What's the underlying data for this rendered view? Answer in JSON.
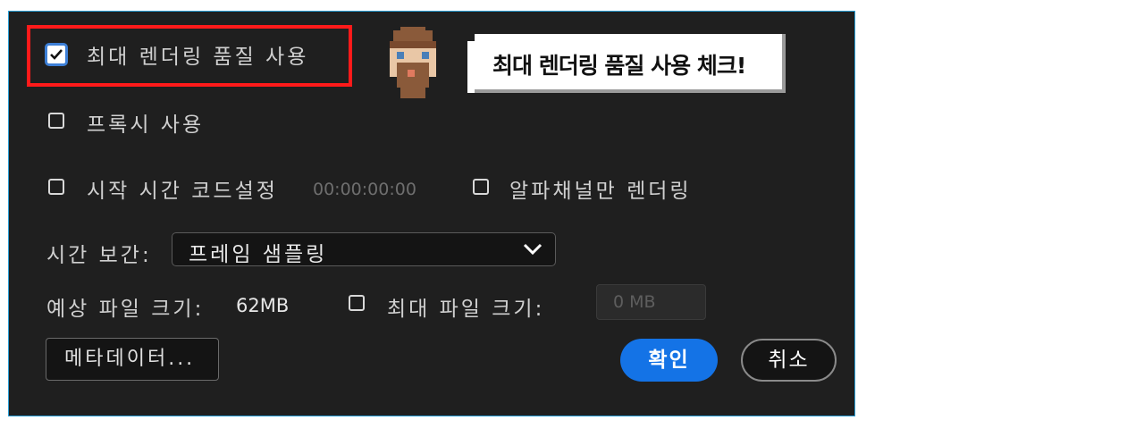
{
  "dialog": {
    "max_quality": {
      "label": "최대 렌더링 품질 사용",
      "checked": true
    },
    "proxy": {
      "label": "프록시 사용",
      "checked": false
    },
    "start_timecode": {
      "label": "시작 시간 코드설정",
      "value": "00:00:00:00",
      "checked": false
    },
    "alpha_only": {
      "label": "알파채널만 렌더링",
      "checked": false
    },
    "time_interpolation": {
      "label": "시간 보간:",
      "selected": "프레임 샘플링"
    },
    "estimated_size": {
      "label": "예상 파일 크기:",
      "value": "62MB"
    },
    "max_file_size": {
      "label": "최대 파일 크기:",
      "value": "0 MB",
      "checked": false
    },
    "buttons": {
      "metadata": "메타데이터...",
      "ok": "확인",
      "cancel": "취소"
    }
  },
  "callout": {
    "text": "최대 렌더링 품질 사용 체크!"
  },
  "icons": [
    "checkmark-icon",
    "chevron-down-icon",
    "pixel-avatar-icon"
  ],
  "colors": {
    "accent": "#1473e6",
    "highlight": "#ff1a1a",
    "dialog_bg": "#1f1f1f"
  }
}
